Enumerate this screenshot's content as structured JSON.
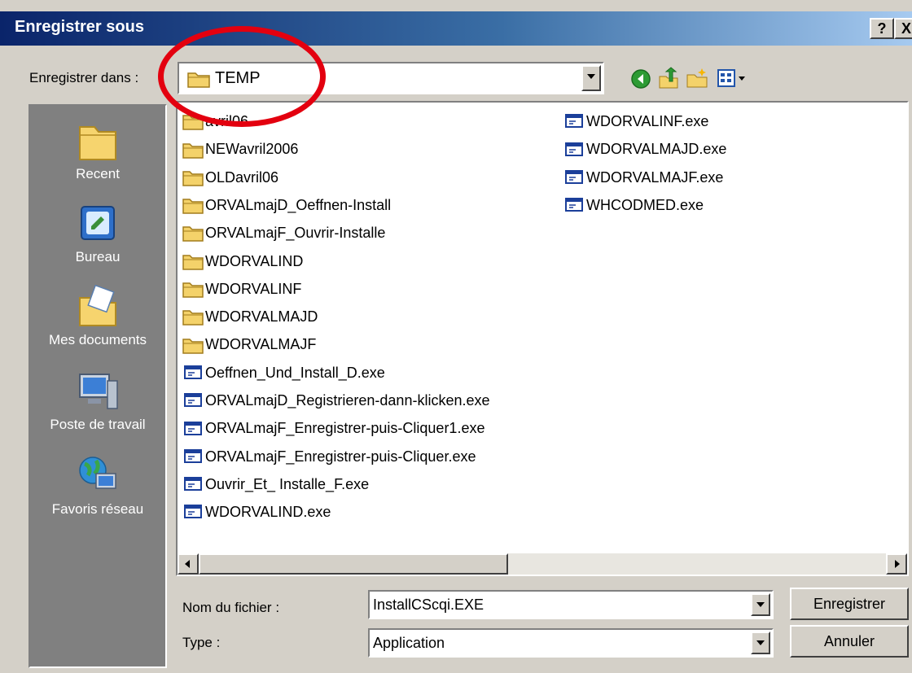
{
  "window": {
    "title": "Enregistrer sous",
    "help_label": "?",
    "close_label": "X"
  },
  "toolbar": {
    "save_in_label": "Enregistrer dans :",
    "current_folder": "TEMP",
    "icons": [
      "back-icon",
      "up-folder-icon",
      "new-folder-icon",
      "view-menu-icon"
    ]
  },
  "places": [
    {
      "label": "Recent",
      "icon": "recent-folder-icon"
    },
    {
      "label": "Bureau",
      "icon": "desktop-icon"
    },
    {
      "label": "Mes documents",
      "icon": "my-documents-icon"
    },
    {
      "label": "Poste de travail",
      "icon": "my-computer-icon"
    },
    {
      "label": "Favoris réseau",
      "icon": "network-icon"
    }
  ],
  "files": {
    "column1": [
      {
        "name": "avril06",
        "type": "folder"
      },
      {
        "name": "NEWavril2006",
        "type": "folder"
      },
      {
        "name": "OLDavril06",
        "type": "folder"
      },
      {
        "name": "ORVALmajD_Oeffnen-Install",
        "type": "folder"
      },
      {
        "name": "ORVALmajF_Ouvrir-Installe",
        "type": "folder"
      },
      {
        "name": "WDORVALIND",
        "type": "folder"
      },
      {
        "name": "WDORVALINF",
        "type": "folder"
      },
      {
        "name": "WDORVALMAJD",
        "type": "folder"
      },
      {
        "name": "WDORVALMAJF",
        "type": "folder"
      },
      {
        "name": "Oeffnen_Und_Install_D.exe",
        "type": "exe"
      },
      {
        "name": "ORVALmajD_Registrieren-dann-klicken.exe",
        "type": "exe"
      },
      {
        "name": "ORVALmajF_Enregistrer-puis-Cliquer1.exe",
        "type": "exe"
      },
      {
        "name": "ORVALmajF_Enregistrer-puis-Cliquer.exe",
        "type": "exe"
      },
      {
        "name": "Ouvrir_Et_ Installe_F.exe",
        "type": "exe"
      },
      {
        "name": "WDORVALIND.exe",
        "type": "exe"
      }
    ],
    "column2": [
      {
        "name": "WDORVALINF.exe",
        "type": "exe"
      },
      {
        "name": "WDORVALMAJD.exe",
        "type": "exe"
      },
      {
        "name": "WDORVALMAJF.exe",
        "type": "exe"
      },
      {
        "name": "WHCODMED.exe",
        "type": "exe"
      }
    ]
  },
  "form": {
    "filename_label": "Nom du fichier :",
    "filename_value": "InstallCScqi.EXE",
    "type_label": "Type :",
    "type_value": "Application",
    "save_button": "Enregistrer",
    "cancel_button": "Annuler"
  },
  "annotation": {
    "color": "#e3000f",
    "shape": "red-ellipse-highlight"
  }
}
